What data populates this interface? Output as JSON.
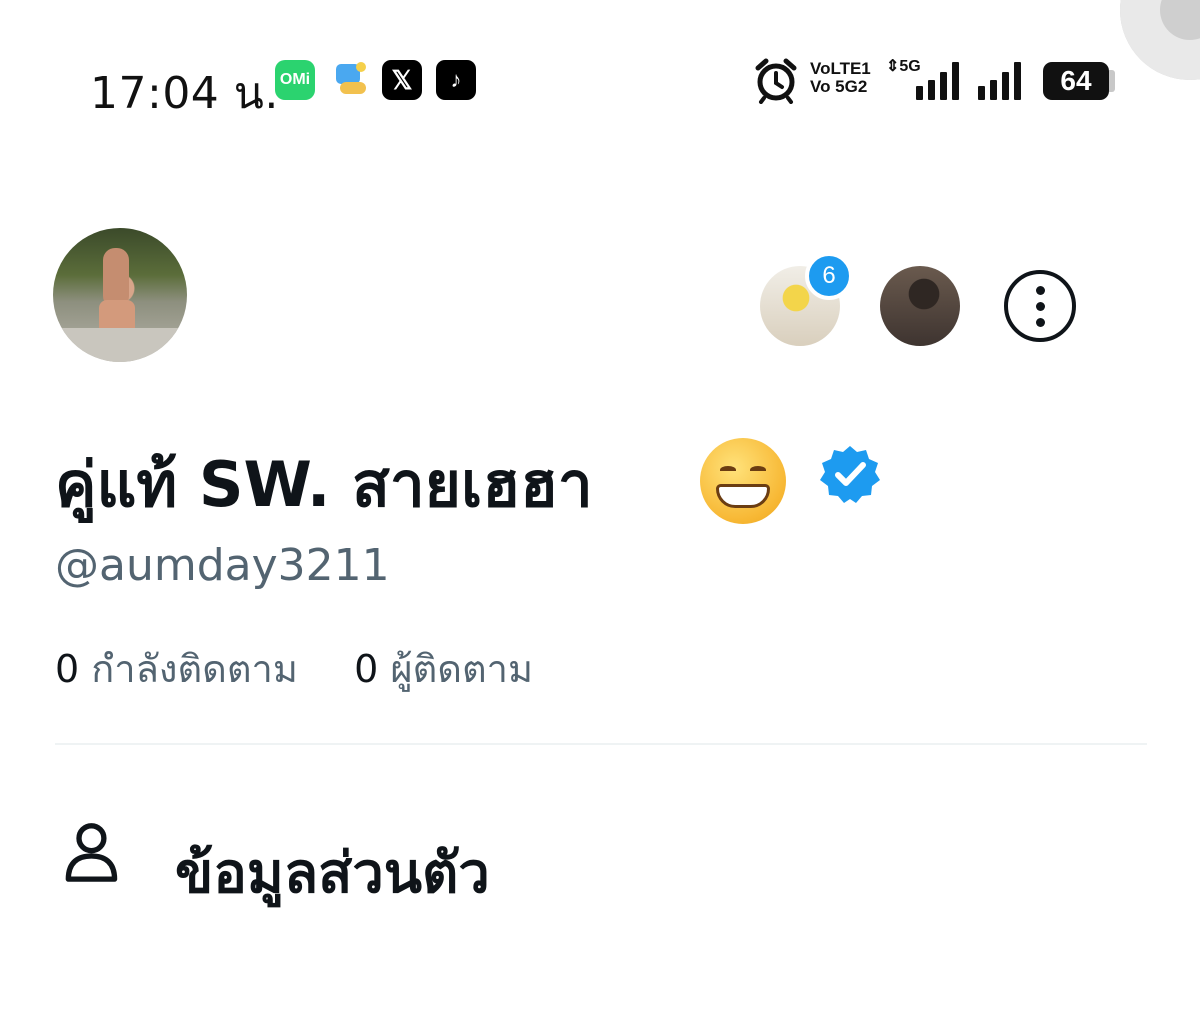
{
  "status_bar": {
    "time": "17:04 น.",
    "app_icons": [
      "omi-icon",
      "coin-app-icon",
      "x-app-icon",
      "tiktok-icon"
    ],
    "omi_label": "OMi",
    "x_glyph": "𝕏",
    "tiktok_glyph": "♪",
    "volte_line1": "VoLTE1",
    "volte_line2": "Vo 5G2",
    "network": "5G",
    "battery": "64"
  },
  "profile": {
    "display_name": "คู่แท้ SW. สายเฮฮา",
    "handle": "@aumday3211",
    "following_count": "0",
    "following_label": "กำลังติดตาม",
    "followers_count": "0",
    "followers_label": "ผู้ติดตาม",
    "mutual_badge_count": "6",
    "verified": true
  },
  "section": {
    "label": "ข้อมูลส่วนตัว",
    "icon": "person-icon"
  },
  "colors": {
    "accent": "#1d9bf0",
    "text_primary": "#0f1419",
    "text_secondary": "#536471",
    "divider": "#eff3f4",
    "omi_green": "#2bd36f"
  }
}
